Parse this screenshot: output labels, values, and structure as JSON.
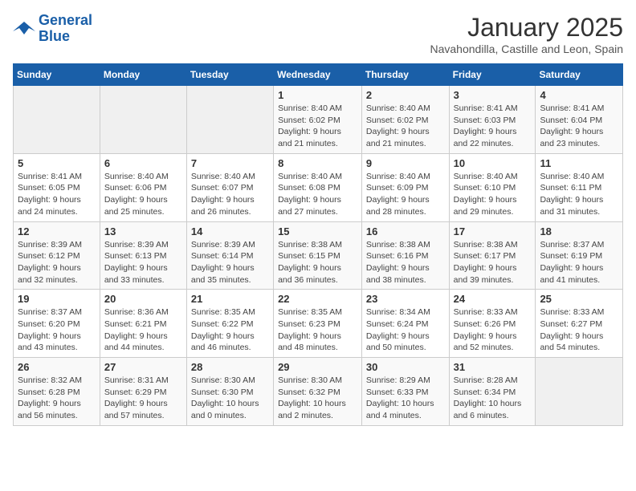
{
  "header": {
    "logo_line1": "General",
    "logo_line2": "Blue",
    "title": "January 2025",
    "subtitle": "Navahondilla, Castille and Leon, Spain"
  },
  "weekdays": [
    "Sunday",
    "Monday",
    "Tuesday",
    "Wednesday",
    "Thursday",
    "Friday",
    "Saturday"
  ],
  "weeks": [
    [
      {
        "day": "",
        "info": ""
      },
      {
        "day": "",
        "info": ""
      },
      {
        "day": "",
        "info": ""
      },
      {
        "day": "1",
        "info": "Sunrise: 8:40 AM\nSunset: 6:02 PM\nDaylight: 9 hours\nand 21 minutes."
      },
      {
        "day": "2",
        "info": "Sunrise: 8:40 AM\nSunset: 6:02 PM\nDaylight: 9 hours\nand 21 minutes."
      },
      {
        "day": "3",
        "info": "Sunrise: 8:41 AM\nSunset: 6:03 PM\nDaylight: 9 hours\nand 22 minutes."
      },
      {
        "day": "4",
        "info": "Sunrise: 8:41 AM\nSunset: 6:04 PM\nDaylight: 9 hours\nand 23 minutes."
      }
    ],
    [
      {
        "day": "5",
        "info": "Sunrise: 8:41 AM\nSunset: 6:05 PM\nDaylight: 9 hours\nand 24 minutes."
      },
      {
        "day": "6",
        "info": "Sunrise: 8:40 AM\nSunset: 6:06 PM\nDaylight: 9 hours\nand 25 minutes."
      },
      {
        "day": "7",
        "info": "Sunrise: 8:40 AM\nSunset: 6:07 PM\nDaylight: 9 hours\nand 26 minutes."
      },
      {
        "day": "8",
        "info": "Sunrise: 8:40 AM\nSunset: 6:08 PM\nDaylight: 9 hours\nand 27 minutes."
      },
      {
        "day": "9",
        "info": "Sunrise: 8:40 AM\nSunset: 6:09 PM\nDaylight: 9 hours\nand 28 minutes."
      },
      {
        "day": "10",
        "info": "Sunrise: 8:40 AM\nSunset: 6:10 PM\nDaylight: 9 hours\nand 29 minutes."
      },
      {
        "day": "11",
        "info": "Sunrise: 8:40 AM\nSunset: 6:11 PM\nDaylight: 9 hours\nand 31 minutes."
      }
    ],
    [
      {
        "day": "12",
        "info": "Sunrise: 8:39 AM\nSunset: 6:12 PM\nDaylight: 9 hours\nand 32 minutes."
      },
      {
        "day": "13",
        "info": "Sunrise: 8:39 AM\nSunset: 6:13 PM\nDaylight: 9 hours\nand 33 minutes."
      },
      {
        "day": "14",
        "info": "Sunrise: 8:39 AM\nSunset: 6:14 PM\nDaylight: 9 hours\nand 35 minutes."
      },
      {
        "day": "15",
        "info": "Sunrise: 8:38 AM\nSunset: 6:15 PM\nDaylight: 9 hours\nand 36 minutes."
      },
      {
        "day": "16",
        "info": "Sunrise: 8:38 AM\nSunset: 6:16 PM\nDaylight: 9 hours\nand 38 minutes."
      },
      {
        "day": "17",
        "info": "Sunrise: 8:38 AM\nSunset: 6:17 PM\nDaylight: 9 hours\nand 39 minutes."
      },
      {
        "day": "18",
        "info": "Sunrise: 8:37 AM\nSunset: 6:19 PM\nDaylight: 9 hours\nand 41 minutes."
      }
    ],
    [
      {
        "day": "19",
        "info": "Sunrise: 8:37 AM\nSunset: 6:20 PM\nDaylight: 9 hours\nand 43 minutes."
      },
      {
        "day": "20",
        "info": "Sunrise: 8:36 AM\nSunset: 6:21 PM\nDaylight: 9 hours\nand 44 minutes."
      },
      {
        "day": "21",
        "info": "Sunrise: 8:35 AM\nSunset: 6:22 PM\nDaylight: 9 hours\nand 46 minutes."
      },
      {
        "day": "22",
        "info": "Sunrise: 8:35 AM\nSunset: 6:23 PM\nDaylight: 9 hours\nand 48 minutes."
      },
      {
        "day": "23",
        "info": "Sunrise: 8:34 AM\nSunset: 6:24 PM\nDaylight: 9 hours\nand 50 minutes."
      },
      {
        "day": "24",
        "info": "Sunrise: 8:33 AM\nSunset: 6:26 PM\nDaylight: 9 hours\nand 52 minutes."
      },
      {
        "day": "25",
        "info": "Sunrise: 8:33 AM\nSunset: 6:27 PM\nDaylight: 9 hours\nand 54 minutes."
      }
    ],
    [
      {
        "day": "26",
        "info": "Sunrise: 8:32 AM\nSunset: 6:28 PM\nDaylight: 9 hours\nand 56 minutes."
      },
      {
        "day": "27",
        "info": "Sunrise: 8:31 AM\nSunset: 6:29 PM\nDaylight: 9 hours\nand 57 minutes."
      },
      {
        "day": "28",
        "info": "Sunrise: 8:30 AM\nSunset: 6:30 PM\nDaylight: 10 hours\nand 0 minutes."
      },
      {
        "day": "29",
        "info": "Sunrise: 8:30 AM\nSunset: 6:32 PM\nDaylight: 10 hours\nand 2 minutes."
      },
      {
        "day": "30",
        "info": "Sunrise: 8:29 AM\nSunset: 6:33 PM\nDaylight: 10 hours\nand 4 minutes."
      },
      {
        "day": "31",
        "info": "Sunrise: 8:28 AM\nSunset: 6:34 PM\nDaylight: 10 hours\nand 6 minutes."
      },
      {
        "day": "",
        "info": ""
      }
    ]
  ]
}
